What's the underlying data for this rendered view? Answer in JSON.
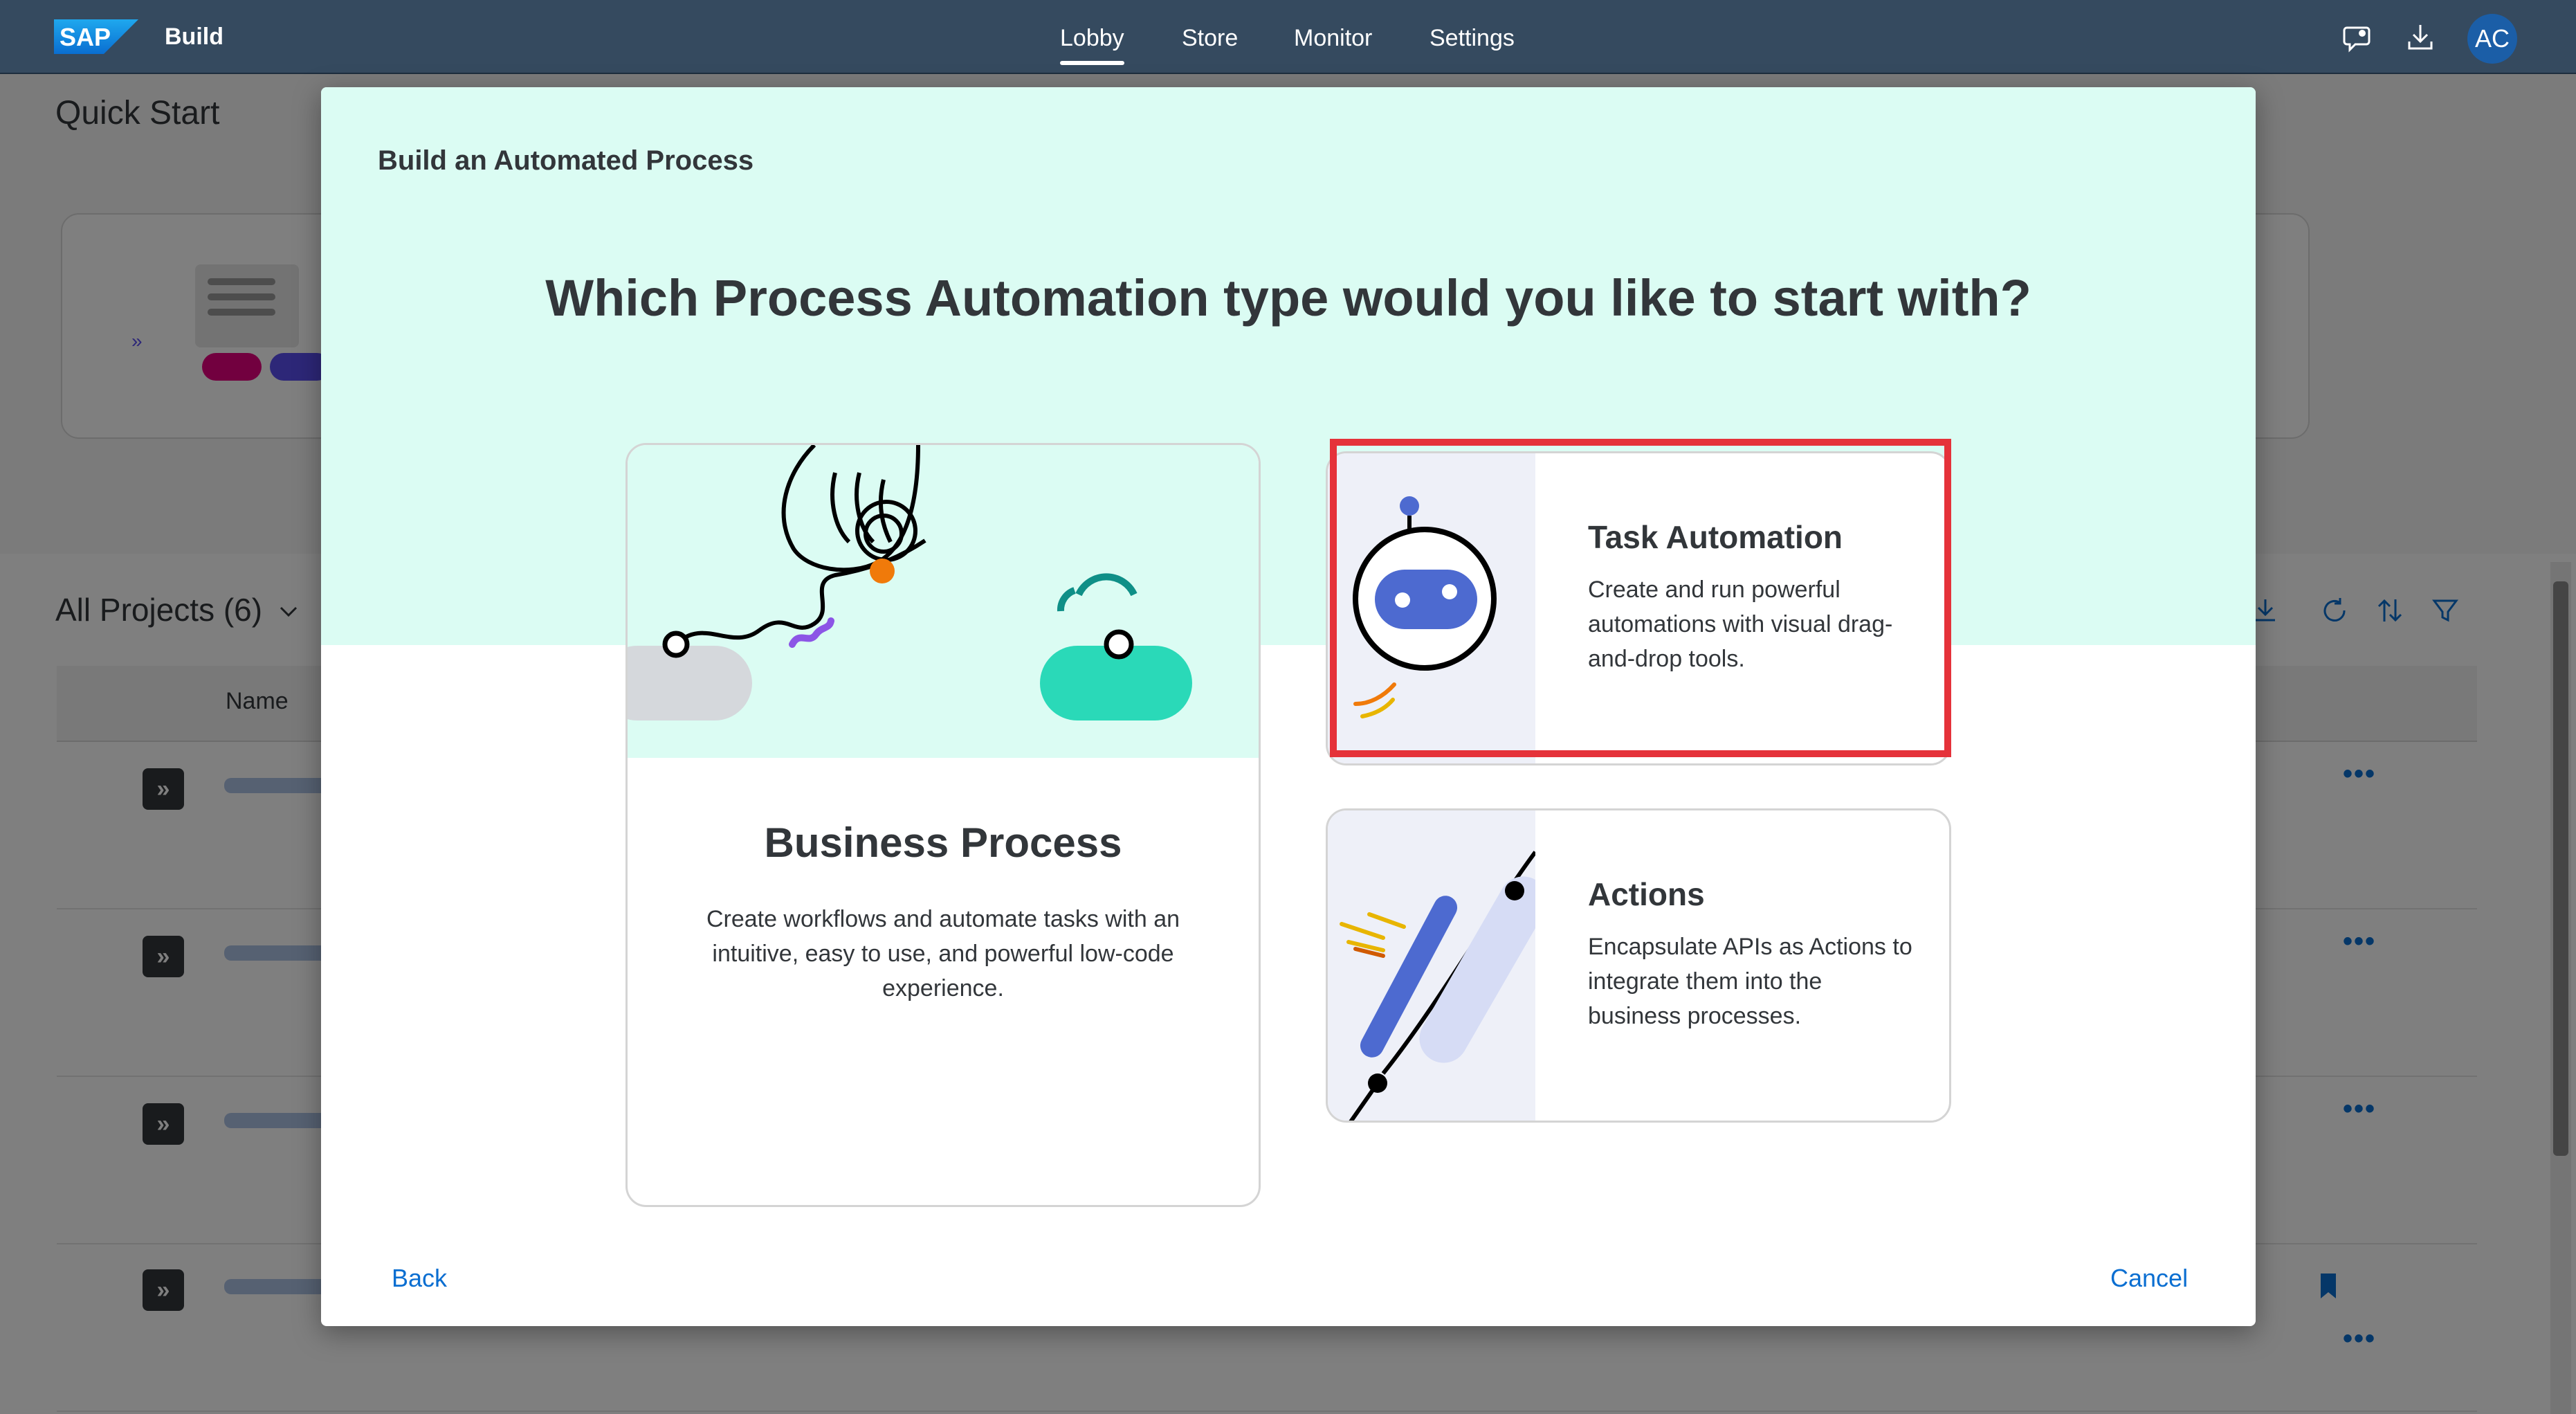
{
  "shell": {
    "product": "Build",
    "nav": [
      "Lobby",
      "Store",
      "Monitor",
      "Settings"
    ],
    "active_nav": "Lobby",
    "avatar_initials": "AC",
    "icons": [
      "feedback-icon",
      "download-icon"
    ]
  },
  "page": {
    "title": "Quick Start",
    "projects_title": "All Projects (6)",
    "table_header_name": "Name"
  },
  "dialog": {
    "header": "Build an Automated Process",
    "question": "Which Process Automation type would you like to start with?",
    "business_process": {
      "title": "Business Process",
      "description": "Create workflows and automate tasks with an intuitive, easy to use, and powerful low-code experience."
    },
    "task_automation": {
      "title": "Task Automation",
      "description": "Create and run powerful automations with visual drag-and-drop tools."
    },
    "actions": {
      "title": "Actions",
      "description": "Encapsulate APIs as Actions to integrate them into the business processes."
    },
    "back_label": "Back",
    "cancel_label": "Cancel"
  },
  "colors": {
    "shell": "#354a5f",
    "mint": "#dbfcf3",
    "link": "#0a6ed1",
    "highlight": "#e5323a"
  }
}
